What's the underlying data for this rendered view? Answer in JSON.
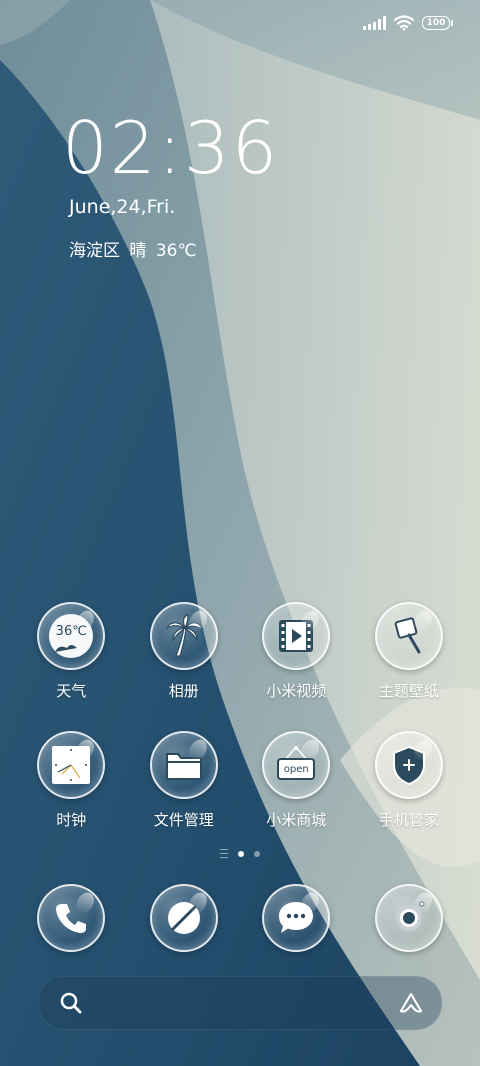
{
  "status_bar": {
    "battery": "100",
    "signal_icon": "signal-bars-icon",
    "wifi_icon": "wifi-icon"
  },
  "lock": {
    "time": "02:36",
    "date": "June,24,Fri.",
    "weather": "海淀区  晴  36℃"
  },
  "apps_row1": [
    {
      "label": "天气",
      "icon": "weather-icon",
      "badge": "36℃"
    },
    {
      "label": "相册",
      "icon": "palm-tree-icon"
    },
    {
      "label": "小米视频",
      "icon": "film-play-icon"
    },
    {
      "label": "主题壁纸",
      "icon": "paint-brush-icon"
    }
  ],
  "apps_row2": [
    {
      "label": "时钟",
      "icon": "clock-icon"
    },
    {
      "label": "文件管理",
      "icon": "folder-icon"
    },
    {
      "label": "小米商城",
      "icon": "store-sign-icon",
      "sign_text": "open"
    },
    {
      "label": "手机管家",
      "icon": "shield-icon"
    }
  ],
  "dock": [
    {
      "icon": "phone-icon"
    },
    {
      "icon": "browser-icon"
    },
    {
      "icon": "message-icon"
    },
    {
      "icon": "camera-icon"
    }
  ],
  "search_bar": {
    "search_icon": "search-icon",
    "assistant_icon": "assistant-icon"
  },
  "colors": {
    "wallpaper_dark": "#1f4a6b",
    "wallpaper_light": "#d9ddd3",
    "icon_stroke": "#2b4a5e"
  }
}
